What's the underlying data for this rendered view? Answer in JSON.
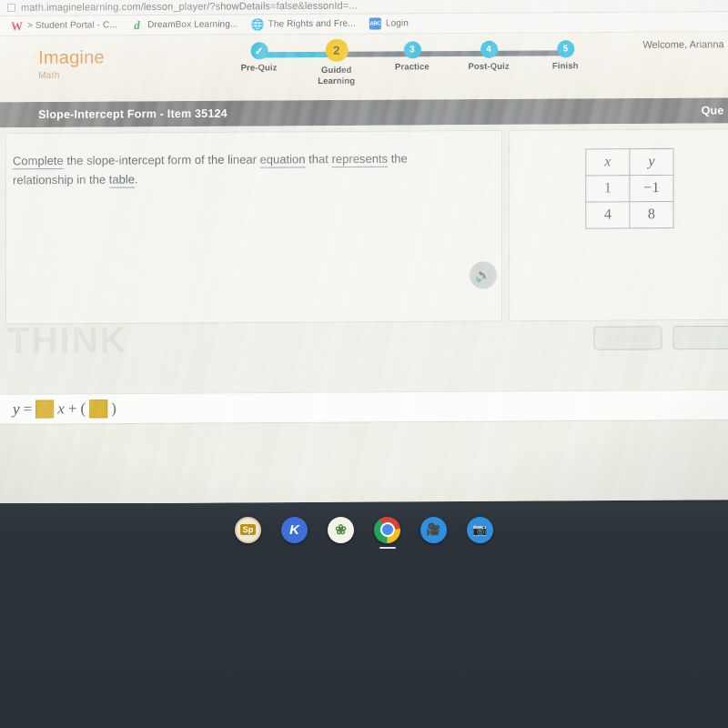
{
  "browser": {
    "url": "math.imaginelearning.com/lesson_player/?showDetails=false&lessonId=...",
    "url_icon": "page-icon",
    "bookmarks": [
      {
        "label": "> Student Portal - C...",
        "icon": "wordpress-w-icon"
      },
      {
        "label": "DreamBox Learning...",
        "icon": "dreambox-d-icon"
      },
      {
        "label": "The Rights and Fre...",
        "icon": "globe-icon"
      },
      {
        "label": "Login",
        "icon": "abc-login-icon"
      }
    ]
  },
  "app_header": {
    "logo_main": "Imagine",
    "logo_sub": "Math",
    "welcome": "Welcome, Arianna",
    "stepper": [
      {
        "number": "✓",
        "label": "Pre-Quiz",
        "state": "completed"
      },
      {
        "number": "2",
        "label": "Guided\nLearning",
        "label_line1": "Guided",
        "label_line2": "Learning",
        "state": "active"
      },
      {
        "number": "3",
        "label": "Practice",
        "state": "upcoming"
      },
      {
        "number": "4",
        "label": "Post-Quiz",
        "state": "upcoming"
      },
      {
        "number": "5",
        "label": "Finish",
        "state": "upcoming"
      }
    ]
  },
  "title_bar": {
    "title": "Slope-Intercept Form - Item 35124",
    "question_label": "Que"
  },
  "question": {
    "parts": [
      {
        "text": "Complete",
        "glossary": true
      },
      {
        "text": " the slope-intercept form of the linear ",
        "glossary": false
      },
      {
        "text": "equation",
        "glossary": true
      },
      {
        "text": " that ",
        "glossary": false
      },
      {
        "text": "represents",
        "glossary": true
      },
      {
        "text": " the relationship in the ",
        "glossary": false
      },
      {
        "text": "table",
        "glossary": true
      },
      {
        "text": ".",
        "glossary": false
      }
    ],
    "speaker_icon": "speaker-icon",
    "watermark": "THINK"
  },
  "table": {
    "headers": [
      "x",
      "y"
    ],
    "rows": [
      [
        "1",
        "−1"
      ],
      [
        "4",
        "8"
      ]
    ]
  },
  "buttons": {
    "clear": "CLEAR",
    "check": "CHE"
  },
  "answer": {
    "lhs": "y",
    "equals": "=",
    "slope_value": "",
    "variable": "x",
    "plus": "+",
    "open_paren": "(",
    "intercept_value": "",
    "close_paren": ")"
  },
  "dock": {
    "items": [
      {
        "icon": "sprout-sp-icon",
        "label": "Sp"
      },
      {
        "icon": "kami-k-icon",
        "label": "K"
      },
      {
        "icon": "plant-leaf-icon",
        "label": "❀"
      },
      {
        "icon": "chrome-icon",
        "label": ""
      },
      {
        "icon": "video-camera-icon",
        "label": "■"
      },
      {
        "icon": "camera-icon",
        "label": "●"
      }
    ]
  },
  "colors": {
    "brand_orange": "#e2893c",
    "step_active": "#f0c017",
    "step_blue": "#29b6dd",
    "title_bar": "#6d6d6d",
    "input_blank": "#d4ab1f"
  }
}
